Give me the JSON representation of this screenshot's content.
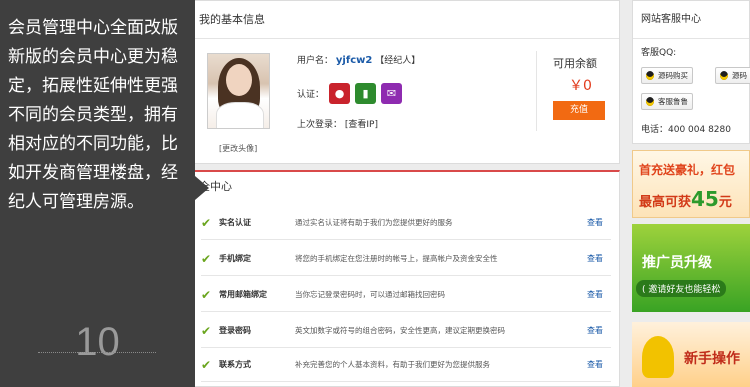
{
  "info": {
    "title": "我的基本信息",
    "change_photo": "[更改头像]",
    "username_label": "用户名：",
    "username": "yjfcw2",
    "role": "【经纪人】",
    "verify_label": "认证：",
    "last_login_label": "上次登录：",
    "view_ip": "[查看IP]",
    "balance_label": "可用余额",
    "balance_value": "￥0",
    "recharge": "充值"
  },
  "security": {
    "title": "全中心",
    "rows": [
      {
        "name": "实名认证",
        "desc": "通过实名认证将有助于我们为您提供更好的服务",
        "action": "查看"
      },
      {
        "name": "手机绑定",
        "desc": "将您的手机绑定在您注册时的帐号上，提高帐户及资金安全性",
        "action": "查看"
      },
      {
        "name": "常用邮箱绑定",
        "desc": "当你忘记登录密码时，可以通过邮箱找回密码",
        "action": "查看"
      },
      {
        "name": "登录密码",
        "desc": "英文加数字或符号的组合密码，安全性更高，建议定期更换密码",
        "action": "查看"
      },
      {
        "name": "联系方式",
        "desc": "补充完善您的个人基本资料，有助于我们更好为您提供服务",
        "action": "查看"
      }
    ]
  },
  "service": {
    "title": "网站客服中心",
    "qq_label": "客服QQ:",
    "buttons": [
      "源码购买",
      "源码",
      "客服鲁鲁"
    ],
    "phone": "电话：400 004 8280"
  },
  "ads": {
    "a1_line1": "首充送豪礼，红包",
    "a1_line2_prefix": "最高可获",
    "a1_line2_num": "45",
    "a1_line2_suffix": "元",
    "a2_line1": "推广员升级",
    "a2_line2": "( 邀请好友也能轻松",
    "a3_line1": "新手操作"
  },
  "caption": {
    "text": "会员管理中心全面改版新版的会员中心更为稳定，拓展性延伸性更强不同的会员类型，拥有相对应的不同功能，比如开发商管理楼盘，经纪人可管理房源。",
    "number": "10"
  },
  "colors": {
    "caption_bg": "#3f3f3f",
    "link_blue": "#1a5aa8",
    "price_red": "#e23b1c",
    "recharge_orange": "#f26a12",
    "check_green": "#6aa51e"
  }
}
